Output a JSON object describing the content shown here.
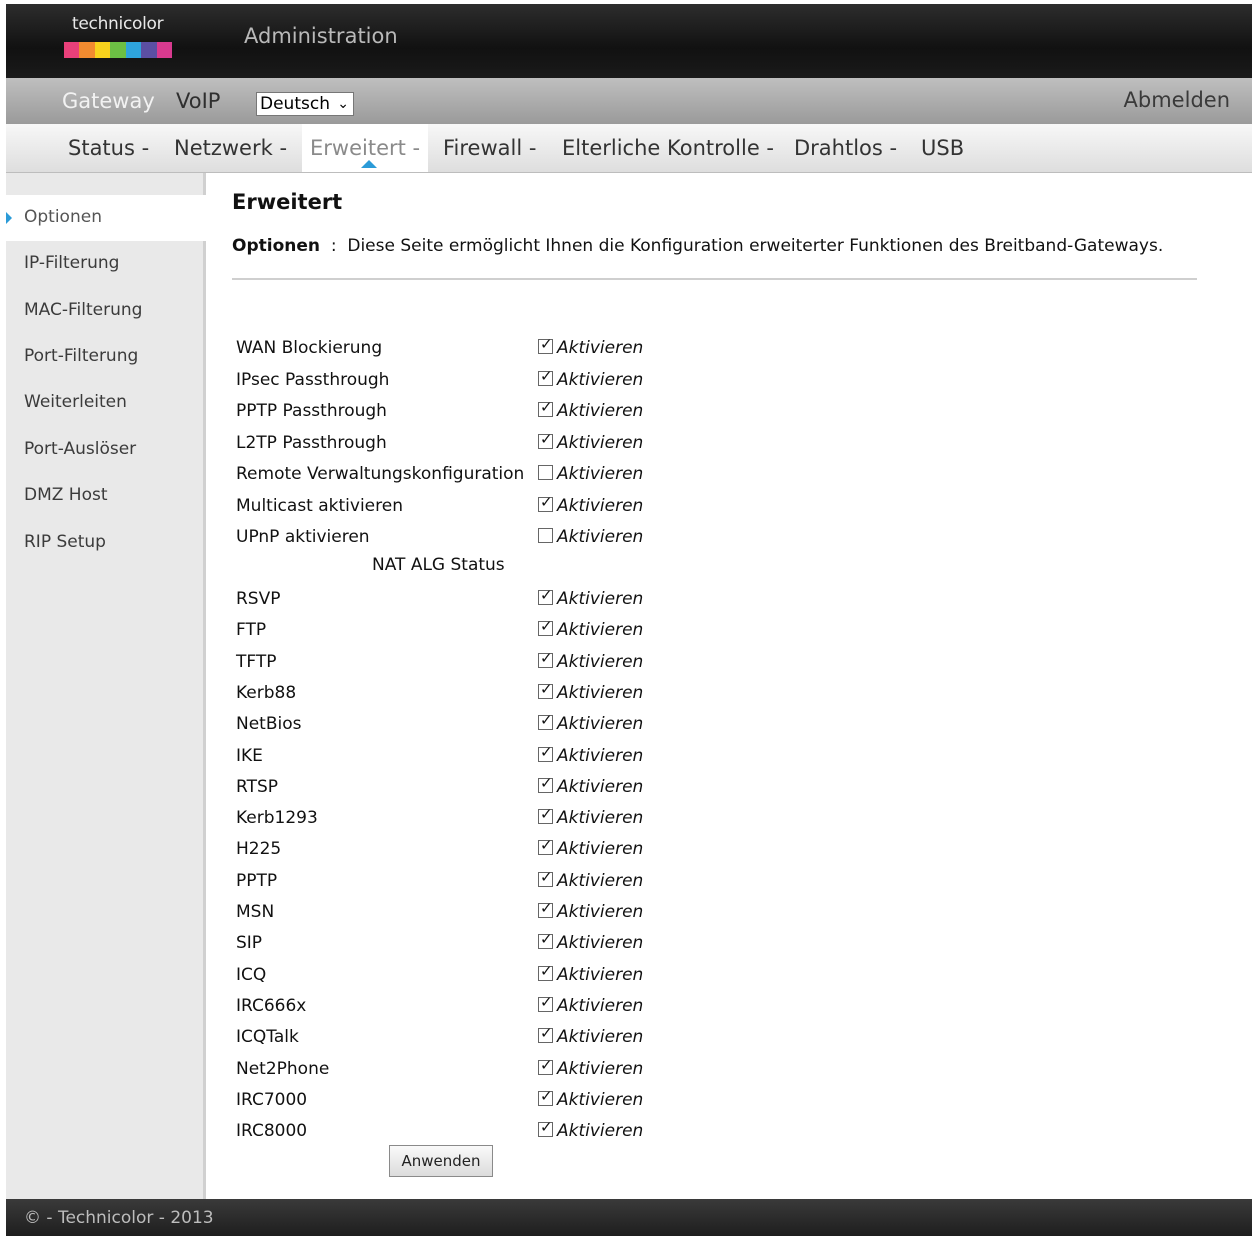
{
  "header": {
    "logo_text": "technicolor",
    "logo_colors": [
      "#e9407a",
      "#f28b30",
      "#f7d21d",
      "#6cbf44",
      "#2ea4dc",
      "#5b4fa3",
      "#d83a8f"
    ],
    "title": "Administration"
  },
  "topnav": {
    "items": [
      "Gateway",
      "VoIP"
    ],
    "language": "Deutsch",
    "logout": "Abmelden"
  },
  "subnav": {
    "items": [
      "Status -",
      "Netzwerk -",
      "Erweitert -",
      "Firewall -",
      "Elterliche Kontrolle -",
      "Drahtlos -",
      "USB"
    ]
  },
  "sidebar": {
    "items": [
      "Optionen",
      "IP-Filterung",
      "MAC-Filterung",
      "Port-Filterung",
      "Weiterleiten",
      "Port-Auslöser",
      "DMZ Host",
      "RIP Setup"
    ]
  },
  "main": {
    "title": "Erweitert",
    "desc_label": "Optionen",
    "desc_sep": ":",
    "desc_text": "Diese Seite ermöglicht Ihnen die Konfiguration erweiterter Funktionen des Breitband-Gateways.",
    "enable_label": "Aktivieren",
    "options": [
      {
        "label": "WAN Blockierung",
        "checked": true
      },
      {
        "label": "IPsec Passthrough",
        "checked": true
      },
      {
        "label": "PPTP Passthrough",
        "checked": true
      },
      {
        "label": "L2TP Passthrough",
        "checked": true
      },
      {
        "label": "Remote Verwaltungskonfiguration",
        "checked": false
      },
      {
        "label": "Multicast aktivieren",
        "checked": true
      },
      {
        "label": "UPnP aktivieren",
        "checked": false
      }
    ],
    "nat_heading": "NAT ALG Status",
    "nat": [
      {
        "label": "RSVP",
        "checked": true
      },
      {
        "label": "FTP",
        "checked": true
      },
      {
        "label": "TFTP",
        "checked": true
      },
      {
        "label": "Kerb88",
        "checked": true
      },
      {
        "label": "NetBios",
        "checked": true
      },
      {
        "label": "IKE",
        "checked": true
      },
      {
        "label": "RTSP",
        "checked": true
      },
      {
        "label": "Kerb1293",
        "checked": true
      },
      {
        "label": "H225",
        "checked": true
      },
      {
        "label": "PPTP",
        "checked": true
      },
      {
        "label": "MSN",
        "checked": true
      },
      {
        "label": "SIP",
        "checked": true
      },
      {
        "label": "ICQ",
        "checked": true
      },
      {
        "label": "IRC666x",
        "checked": true
      },
      {
        "label": "ICQTalk",
        "checked": true
      },
      {
        "label": "Net2Phone",
        "checked": true
      },
      {
        "label": "IRC7000",
        "checked": true
      },
      {
        "label": "IRC8000",
        "checked": true
      }
    ],
    "apply": "Anwenden"
  },
  "footer": {
    "text": "© - Technicolor - 2013"
  }
}
